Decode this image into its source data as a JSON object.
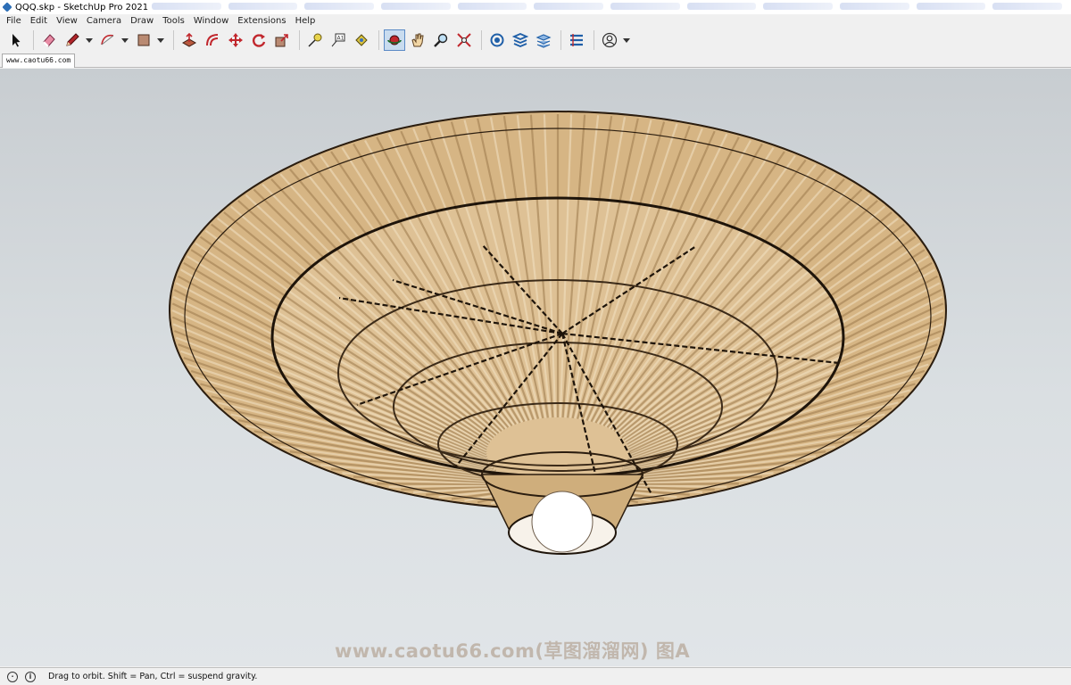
{
  "window": {
    "title": "QQQ.skp - SketchUp Pro 2021"
  },
  "menu": [
    "File",
    "Edit",
    "View",
    "Camera",
    "Draw",
    "Tools",
    "Window",
    "Extensions",
    "Help"
  ],
  "toolbar": {
    "tools": [
      {
        "name": "select-tool",
        "icon": "arrow-icon"
      },
      {
        "name": "eraser-tool",
        "icon": "eraser-icon"
      },
      {
        "name": "line-tool",
        "icon": "pencil-icon",
        "dropdown": true
      },
      {
        "name": "arc-tool",
        "icon": "arc-icon",
        "dropdown": true
      },
      {
        "name": "rectangle-tool",
        "icon": "rectangle-icon",
        "dropdown": true
      },
      {
        "name": "push-pull-tool",
        "icon": "push-pull-icon"
      },
      {
        "name": "offset-tool",
        "icon": "offset-icon"
      },
      {
        "name": "move-tool",
        "icon": "move-icon"
      },
      {
        "name": "rotate-tool",
        "icon": "rotate-icon"
      },
      {
        "name": "scale-tool",
        "icon": "scale-icon"
      },
      {
        "name": "tape-measure-tool",
        "icon": "tape-measure-icon"
      },
      {
        "name": "text-tool",
        "icon": "text-icon"
      },
      {
        "name": "paint-bucket-tool",
        "icon": "paint-bucket-icon"
      },
      {
        "name": "orbit-tool",
        "icon": "orbit-icon",
        "active": true
      },
      {
        "name": "pan-tool",
        "icon": "hand-icon"
      },
      {
        "name": "zoom-tool",
        "icon": "zoom-icon"
      },
      {
        "name": "zoom-extents-tool",
        "icon": "zoom-extents-icon"
      },
      {
        "name": "warehouse-tool",
        "icon": "warehouse-icon"
      },
      {
        "name": "extension-warehouse-tool",
        "icon": "extension-warehouse-icon"
      },
      {
        "name": "layout-tool",
        "icon": "layout-icon"
      },
      {
        "name": "extension-manager-tool",
        "icon": "extension-manager-icon"
      },
      {
        "name": "account-tool",
        "icon": "user-icon",
        "dropdown": true
      }
    ]
  },
  "scene_tab": "www.caotu66.com",
  "viewport": {
    "watermark": "www.caotu66.com(草图溜溜网) 图A",
    "sky_color": "#c8cdd1",
    "ground_color": "#e1e5e8",
    "model_color": "#d6b584"
  },
  "status": {
    "text": "Drag to orbit. Shift = Pan, Ctrl = suspend gravity."
  }
}
